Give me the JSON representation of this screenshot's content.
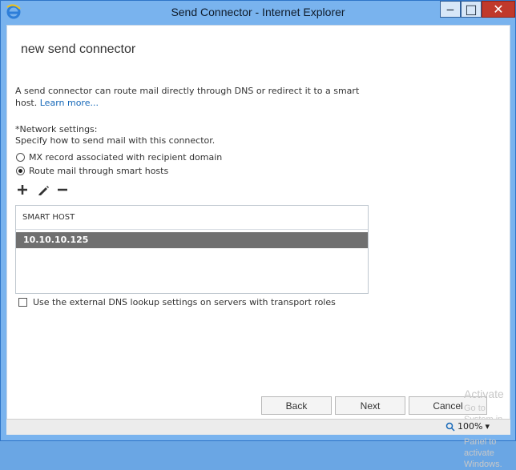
{
  "window": {
    "title": "Send Connector - Internet Explorer",
    "minimize_symbol": "‒",
    "maximize_symbol": "□",
    "close_symbol": "✕"
  },
  "page": {
    "heading": "new send connector",
    "description": "A send connector can route mail directly through DNS or redirect it to a smart host.",
    "learn_more": "Learn more...",
    "network_label": "*Network settings:",
    "network_help": "Specify how to send mail with this connector.",
    "radio_options": [
      {
        "label": "MX record associated with recipient domain",
        "checked": false
      },
      {
        "label": "Route mail through smart hosts",
        "checked": true
      }
    ],
    "toolbar": {
      "add": "add-icon",
      "edit": "edit-icon",
      "remove": "remove-icon"
    },
    "smart_host_header": "SMART HOST",
    "smart_hosts": [
      "10.10.10.125"
    ],
    "dns_checkbox_label": "Use the external DNS lookup settings on servers with transport roles",
    "dns_checkbox_checked": false,
    "buttons": {
      "back": "Back",
      "next": "Next",
      "cancel": "Cancel"
    }
  },
  "watermark": {
    "line1": "Activate",
    "line2": "Go to System in Control Panel to activate Windows."
  },
  "status": {
    "zoom": "100%"
  },
  "colors": {
    "accent": "#1467b8",
    "selected_row": "#707070"
  }
}
